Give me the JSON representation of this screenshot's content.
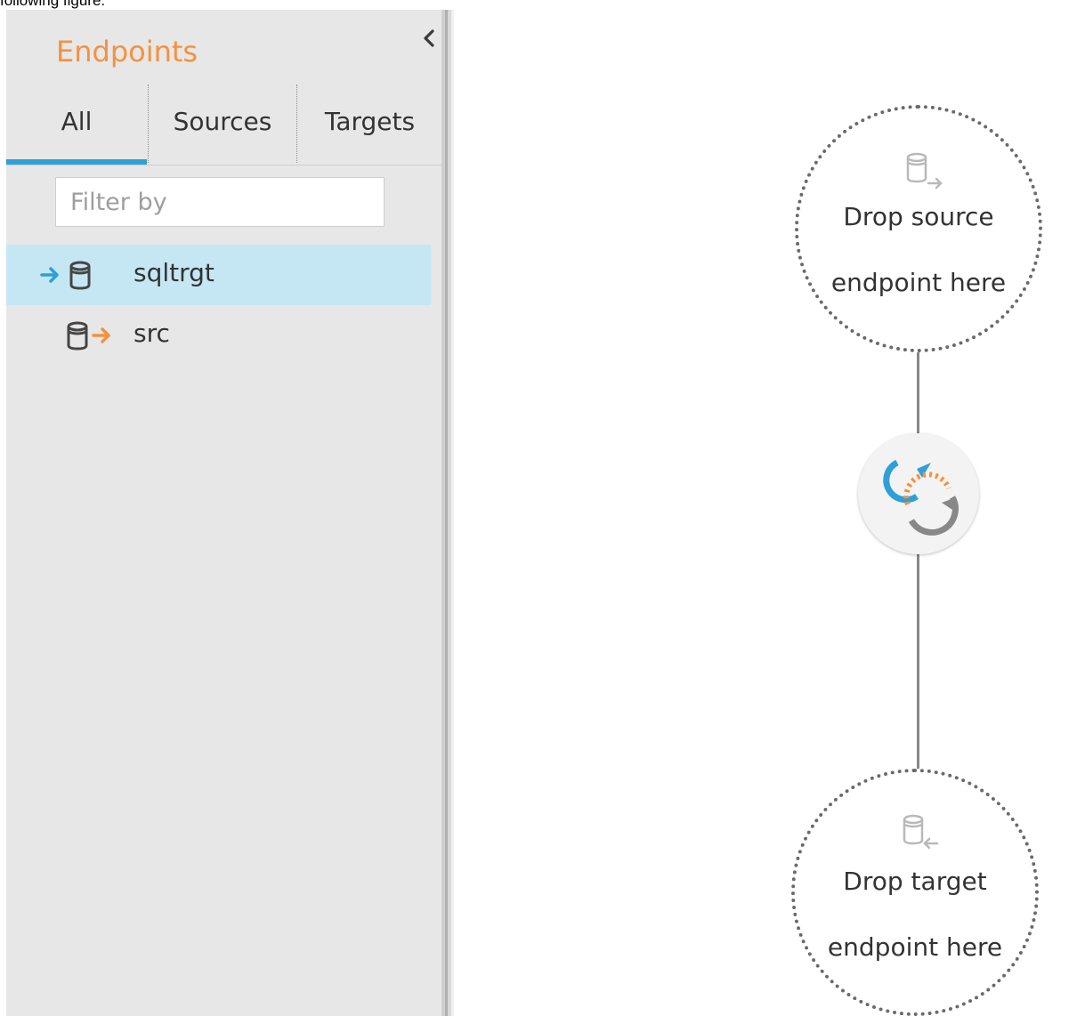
{
  "caption_fragment": "following figure.",
  "sidebar": {
    "title": "Endpoints",
    "collapse_icon": "chevron-left-icon",
    "tabs": [
      {
        "label": "All",
        "active": true
      },
      {
        "label": "Sources",
        "active": false
      },
      {
        "label": "Targets",
        "active": false
      }
    ],
    "filter": {
      "placeholder": "Filter by",
      "value": ""
    },
    "items": [
      {
        "label": "sqltrgt",
        "role": "target",
        "icon": "target-database-icon",
        "selected": true
      },
      {
        "label": "src",
        "role": "source",
        "icon": "source-database-icon",
        "selected": false
      }
    ]
  },
  "canvas": {
    "source_drop": {
      "line1": "Drop source",
      "line2": "endpoint here",
      "icon": "source-database-icon"
    },
    "task_icon": "replication-task-icon",
    "target_drop": {
      "line1": "Drop target",
      "line2": "endpoint here",
      "icon": "target-database-icon"
    }
  },
  "colors": {
    "accent_orange": "#f5913e",
    "accent_blue": "#2f9fd8",
    "selected_row": "#c5e7f4",
    "sidebar_bg": "#e7e7e7"
  }
}
